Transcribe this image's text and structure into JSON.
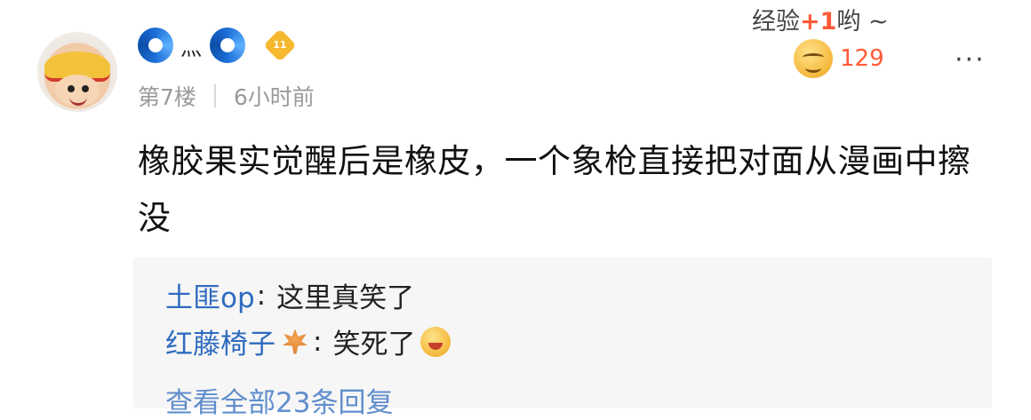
{
  "post": {
    "username_mid": "灬",
    "level": "11",
    "floor": "第7楼",
    "time": "6小时前",
    "exp_label": "经验",
    "exp_gain": "+1",
    "exp_suffix": "哟 ~",
    "reaction_count": "129",
    "more": "···",
    "content": "橡胶果实觉醒后是橡皮，一个象枪直接把对面从漫画中擦没"
  },
  "replies": [
    {
      "name": "土匪op",
      "sep": ":",
      "text": "这里真笑了"
    },
    {
      "name": "红藤椅子",
      "sep": ":",
      "text": "笑死了"
    }
  ],
  "replies_footer": "查看全部23条回复",
  "colors": {
    "accent": "#ff5a37",
    "link": "#2e6bbf",
    "badge": "#f6b82e"
  }
}
